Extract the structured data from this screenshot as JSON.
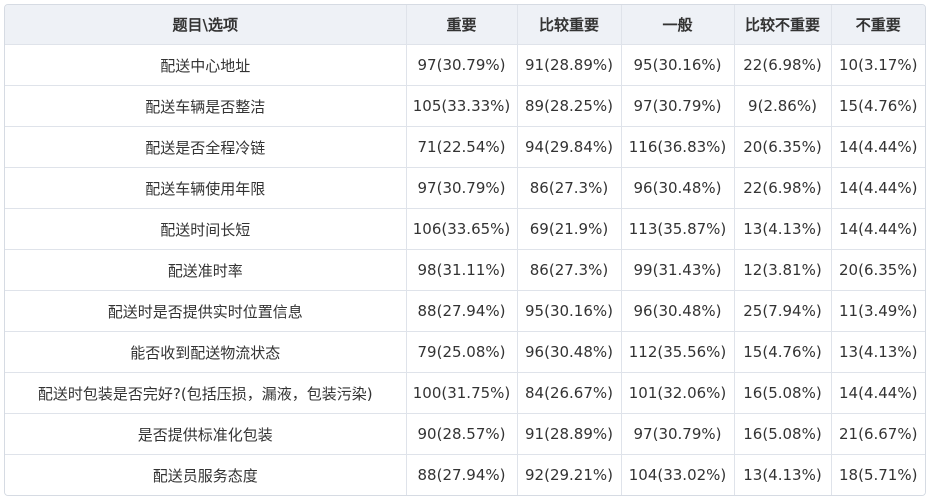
{
  "table": {
    "headers": [
      "题目\\选项",
      "重要",
      "比较重要",
      "一般",
      "比较不重要",
      "不重要"
    ],
    "rows": [
      [
        "配送中心地址",
        "97(30.79%)",
        "91(28.89%)",
        "95(30.16%)",
        "22(6.98%)",
        "10(3.17%)"
      ],
      [
        "配送车辆是否整洁",
        "105(33.33%)",
        "89(28.25%)",
        "97(30.79%)",
        "9(2.86%)",
        "15(4.76%)"
      ],
      [
        "配送是否全程冷链",
        "71(22.54%)",
        "94(29.84%)",
        "116(36.83%)",
        "20(6.35%)",
        "14(4.44%)"
      ],
      [
        "配送车辆使用年限",
        "97(30.79%)",
        "86(27.3%)",
        "96(30.48%)",
        "22(6.98%)",
        "14(4.44%)"
      ],
      [
        "配送时间长短",
        "106(33.65%)",
        "69(21.9%)",
        "113(35.87%)",
        "13(4.13%)",
        "14(4.44%)"
      ],
      [
        "配送准时率",
        "98(31.11%)",
        "86(27.3%)",
        "99(31.43%)",
        "12(3.81%)",
        "20(6.35%)"
      ],
      [
        "配送时是否提供实时位置信息",
        "88(27.94%)",
        "95(30.16%)",
        "96(30.48%)",
        "25(7.94%)",
        "11(3.49%)"
      ],
      [
        "能否收到配送物流状态",
        "79(25.08%)",
        "96(30.48%)",
        "112(35.56%)",
        "15(4.76%)",
        "13(4.13%)"
      ],
      [
        "配送时包装是否完好?(包括压损，漏液，包装污染)",
        "100(31.75%)",
        "84(26.67%)",
        "101(32.06%)",
        "16(5.08%)",
        "14(4.44%)"
      ],
      [
        "是否提供标准化包装",
        "90(28.57%)",
        "91(28.89%)",
        "97(30.79%)",
        "16(5.08%)",
        "21(6.67%)"
      ],
      [
        "配送员服务态度",
        "88(27.94%)",
        "92(29.21%)",
        "104(33.02%)",
        "13(4.13%)",
        "18(5.71%)"
      ]
    ]
  }
}
